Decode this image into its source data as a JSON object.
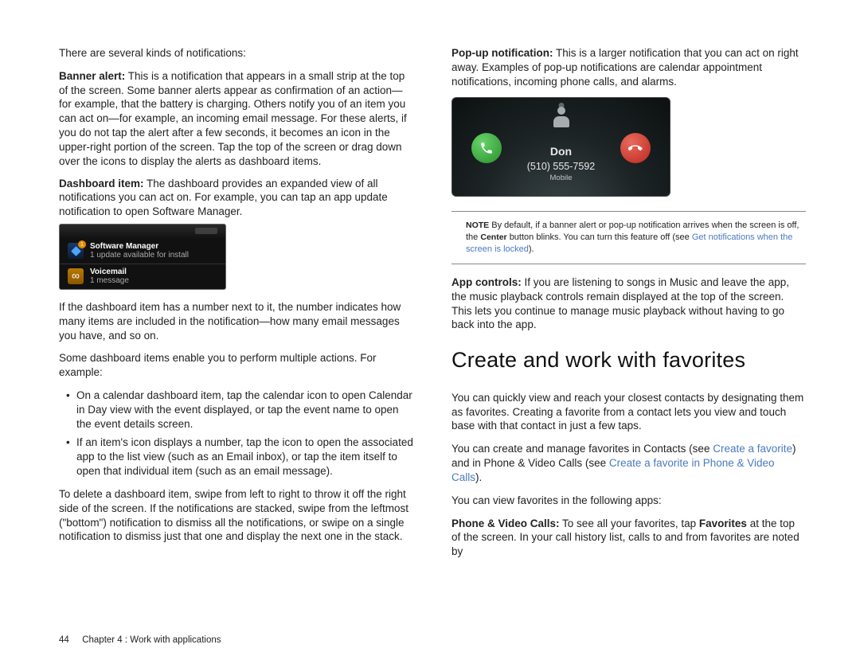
{
  "left": {
    "intro": "There are several kinds of notifications:",
    "banner": {
      "label": "Banner alert:",
      "text": " This is a notification that appears in a small strip at the top of the screen. Some banner alerts appear as confirmation of an action—for example, that the battery is charging. Others notify you of an item you can act on—for example, an incoming email message. For these alerts, if you do not tap the alert after a few seconds, it becomes an icon in the upper-right portion of the screen. Tap the top of the screen or drag down over the icons to display the alerts as dashboard items."
    },
    "dashboard": {
      "label": "Dashboard item:",
      "text": " The dashboard provides an expanded view of all notifications you can act on. For example, you can tap an app update notification to open Software Manager."
    },
    "dash_img": {
      "row1": {
        "title": "Software Manager",
        "sub": "1 update available for install"
      },
      "row2": {
        "title": "Voicemail",
        "sub": "1 message"
      }
    },
    "dash_num": "If the dashboard item has a number next to it, the number indicates how many items are included in the notification—how many email messages you have, and so on.",
    "dash_multi": "Some dashboard items enable you to perform multiple actions. For example:",
    "bullets": [
      "On a calendar dashboard item, tap the calendar icon to open Calendar in Day view with the event displayed, or tap the event name to open the event details screen.",
      "If an item's icon displays a number, tap the icon to open the associated app to the list view (such as an Email inbox), or tap the item itself to open that individual item (such as an email message)."
    ],
    "delete": "To delete a dashboard item, swipe from left to right to throw it off the right side of the screen. If the notifications are stacked, swipe from the leftmost (\"bottom\") notification to dismiss all the notifications, or swipe on a single notification to dismiss just that one and display the next one in the stack."
  },
  "right": {
    "popup": {
      "label": "Pop-up notification:",
      "text": " This is a larger notification that you can act on right away. Examples of pop-up notifications are calendar appointment notifications, incoming phone calls, and alarms."
    },
    "call": {
      "name": "Don",
      "phone": "(510) 555-7592",
      "type": "Mobile"
    },
    "note": {
      "label": "NOTE",
      "text1": "  By default, if a banner alert or pop-up notification arrives when the screen is off, the ",
      "center": "Center",
      "text2": " button blinks. You can turn this feature off (see ",
      "link": "Get notifications when the screen is locked",
      "text3": ")."
    },
    "app": {
      "label": "App controls:",
      "text": " If you are listening to songs in Music and leave the app, the music playback controls remain displayed at the top of the screen. This lets you continue to manage music playback without having to go back into the app."
    },
    "heading": "Create and work with favorites",
    "fav1": "You can quickly view and reach your closest contacts by designating them as favorites. Creating a favorite from a contact lets you view and touch base with that contact in just a few taps.",
    "fav2a": "You can create and manage favorites in Contacts (see ",
    "link1": "Create a favorite",
    "fav2b": ") and in Phone & Video Calls (see ",
    "link2": "Create a favorite in Phone & Video Calls",
    "fav2c": ").",
    "fav3": "You can view favorites in the following apps:",
    "pv": {
      "label": "Phone & Video Calls:",
      "text1": " To see all your favorites, tap ",
      "fav": "Favorites",
      "text2": " at the top of the screen. In your call history list, calls to and from favorites are noted by"
    }
  },
  "footer": {
    "page": "44",
    "chapter": "Chapter 4 : Work with applications"
  }
}
